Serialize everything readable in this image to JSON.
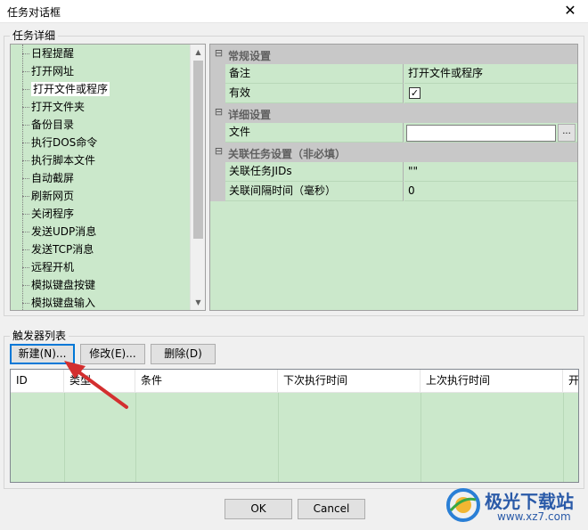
{
  "window": {
    "title": "任务对话框",
    "close_glyph": "✕"
  },
  "task_detail": {
    "group_label": "任务详细",
    "tree_items": [
      "日程提醒",
      "打开网址",
      "打开文件或程序",
      "打开文件夹",
      "备份目录",
      "执行DOS命令",
      "执行脚本文件",
      "自动截屏",
      "刷新网页",
      "关闭程序",
      "发送UDP消息",
      "发送TCP消息",
      "远程开机",
      "模拟键盘按键",
      "模拟键盘输入"
    ],
    "selected_item": "打开文件或程序"
  },
  "properties": {
    "general": {
      "label": "常规设置",
      "note_label": "备注",
      "note_value": "打开文件或程序",
      "enabled_label": "有效",
      "enabled_check": "✓"
    },
    "detail": {
      "label": "详细设置",
      "file_label": "文件",
      "file_value": "",
      "browse_label": "..."
    },
    "related": {
      "label": "关联任务设置（非必填）",
      "jids_label": "关联任务JIDs",
      "jids_value": "\"\"",
      "interval_label": "关联间隔时间（毫秒）",
      "interval_value": "0"
    },
    "collapse_glyph": "⊟"
  },
  "triggers": {
    "group_label": "触发器列表",
    "new_label": "新建(N)...",
    "edit_label": "修改(E)...",
    "delete_label": "删除(D)",
    "columns": [
      "ID",
      "类型",
      "条件",
      "下次执行时间",
      "上次执行时间",
      "开"
    ]
  },
  "footer": {
    "ok_label": "OK",
    "cancel_label": "Cancel"
  },
  "watermark": {
    "name": "极光下载站",
    "url": "www.xz7.com"
  },
  "colors": {
    "list_bg": "#cbe8cb",
    "category_bg": "#c8c8c8",
    "focus": "#0078d7",
    "arrow": "#d32f2f"
  }
}
